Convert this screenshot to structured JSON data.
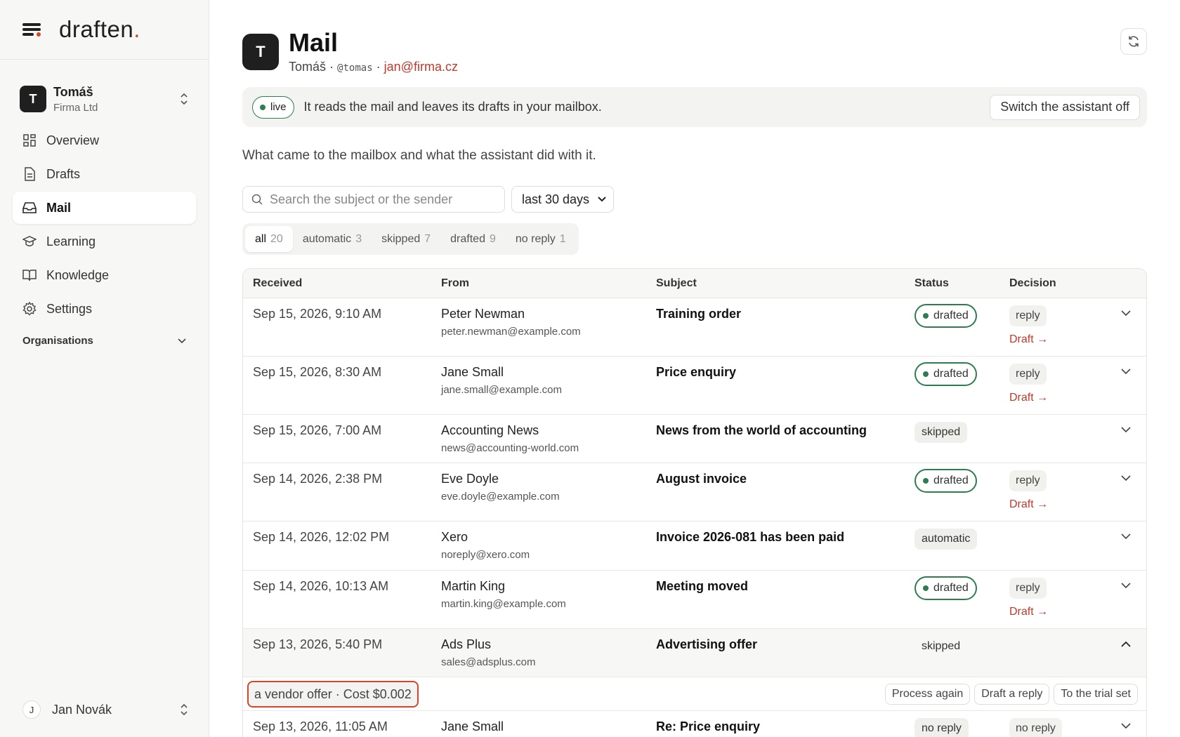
{
  "sidebar": {
    "brand": "draften",
    "brand_dot": ".",
    "workspace": {
      "initial": "T",
      "name": "Tomáš",
      "company": "Firma Ltd"
    },
    "nav": [
      {
        "label": "Overview",
        "icon": "grid-icon"
      },
      {
        "label": "Drafts",
        "icon": "document-icon"
      },
      {
        "label": "Mail",
        "icon": "inbox-icon",
        "active": true
      },
      {
        "label": "Learning",
        "icon": "graduation-cap-icon"
      },
      {
        "label": "Knowledge",
        "icon": "book-icon"
      },
      {
        "label": "Settings",
        "icon": "gear-icon"
      }
    ],
    "organisations_label": "Organisations",
    "user": {
      "initial": "J",
      "name": "Jan Novák"
    }
  },
  "header": {
    "initial": "T",
    "title": "Mail",
    "name": "Tomáš",
    "sep": "·",
    "handle": "@tomas",
    "email": "jan@firma.cz"
  },
  "banner": {
    "status": "live",
    "text": "It reads the mail and leaves its drafts in your mailbox.",
    "switch_label": "Switch the assistant off"
  },
  "description": "What came to the mailbox and what the assistant did with it.",
  "search": {
    "placeholder": "Search the subject or the sender",
    "value": ""
  },
  "period": {
    "selected": "last 30 days"
  },
  "filters": [
    {
      "label": "all",
      "count": "20",
      "active": true
    },
    {
      "label": "automatic",
      "count": "3"
    },
    {
      "label": "skipped",
      "count": "7"
    },
    {
      "label": "drafted",
      "count": "9"
    },
    {
      "label": "no reply",
      "count": "1"
    }
  ],
  "table": {
    "columns": {
      "received": "Received",
      "from": "From",
      "subject": "Subject",
      "status": "Status",
      "decision": "Decision"
    },
    "rows": [
      {
        "received": "Sep 15, 2026, 9:10 AM",
        "name": "Peter Newman",
        "email": "peter.newman@example.com",
        "subject": "Training order",
        "status": "drafted",
        "decision": "reply",
        "link": "Draft →"
      },
      {
        "received": "Sep 15, 2026, 8:30 AM",
        "name": "Jane Small",
        "email": "jane.small@example.com",
        "subject": "Price enquiry",
        "status": "drafted",
        "decision": "reply",
        "link": "Draft →"
      },
      {
        "received": "Sep 15, 2026, 7:00 AM",
        "name": "Accounting News",
        "email": "news@accounting-world.com",
        "subject": "News from the world of accounting",
        "status": "skipped"
      },
      {
        "received": "Sep 14, 2026, 2:38 PM",
        "name": "Eve Doyle",
        "email": "eve.doyle@example.com",
        "subject": "August invoice",
        "status": "drafted",
        "decision": "reply",
        "link": "Draft →"
      },
      {
        "received": "Sep 14, 2026, 12:02 PM",
        "name": "Xero",
        "email": "noreply@xero.com",
        "subject": "Invoice 2026-081 has been paid",
        "status": "automatic"
      },
      {
        "received": "Sep 14, 2026, 10:13 AM",
        "name": "Martin King",
        "email": "martin.king@example.com",
        "subject": "Meeting moved",
        "status": "drafted",
        "decision": "reply",
        "link": "Draft →"
      },
      {
        "received": "Sep 13, 2026, 5:40 PM",
        "name": "Ads Plus",
        "email": "sales@adsplus.com",
        "subject": "Advertising offer",
        "status": "skipped",
        "expanded": true
      },
      {
        "received": "Sep 13, 2026, 11:05 AM",
        "name": "Jane Small",
        "email": "",
        "subject": "Re: Price enquiry",
        "status": "no reply",
        "decision": "no reply"
      }
    ],
    "detail": {
      "cost_text": "a vendor offer · Cost $0.002",
      "actions": [
        "Process again",
        "Draft a reply",
        "To the trial set"
      ]
    }
  },
  "colors": {
    "accent": "#d4432c",
    "live_green": "#2e7d4f",
    "link_red": "#c0392b"
  }
}
